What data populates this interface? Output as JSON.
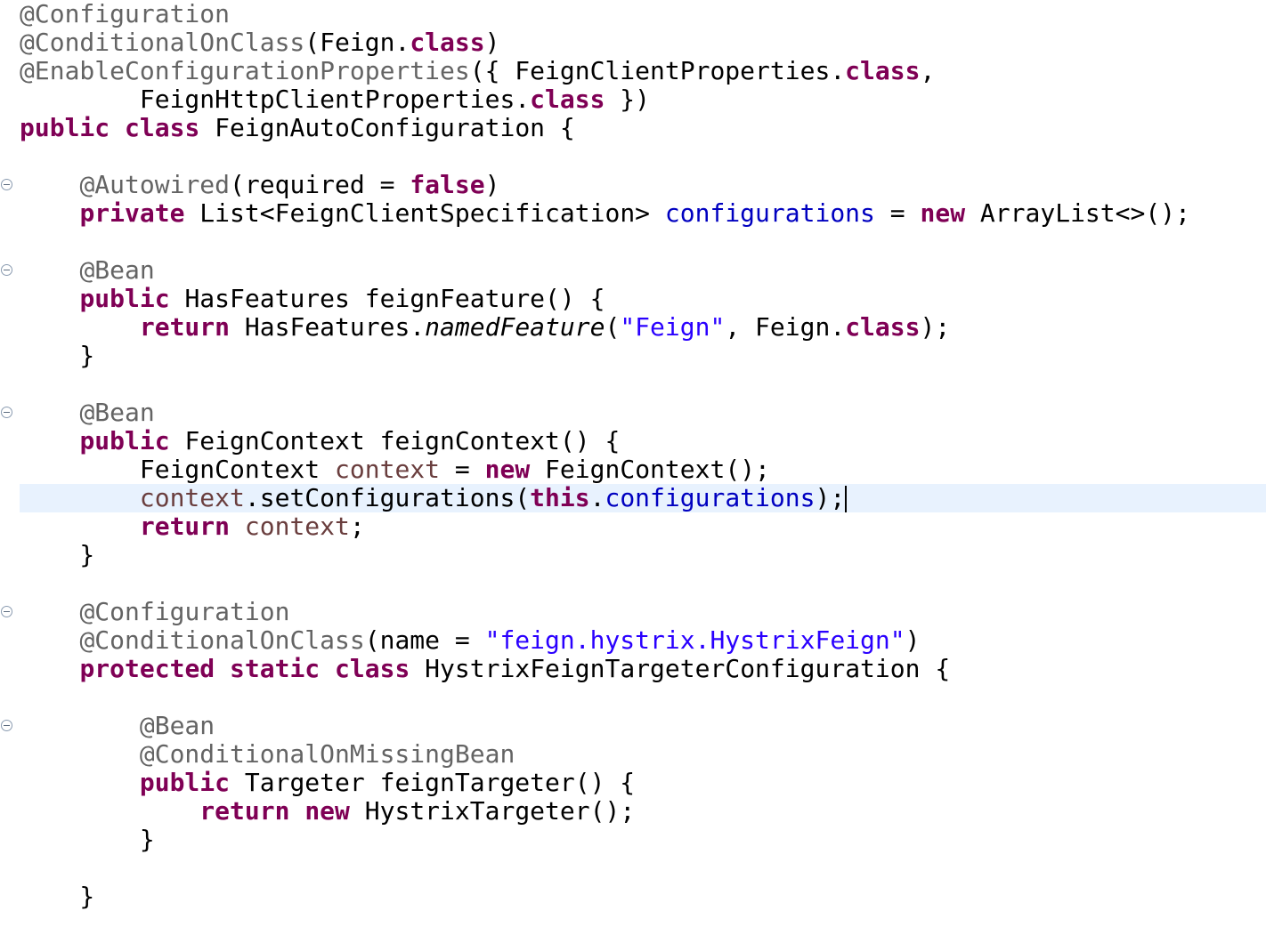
{
  "editor": {
    "fold_markers": [
      "collapse",
      "collapse",
      "collapse",
      "collapse",
      "collapse"
    ],
    "colors": {
      "keyword": "#7f0055",
      "annotation": "#646464",
      "string": "#2a00ff",
      "field": "#0000c0",
      "local_variable": "#6a3e3e",
      "plain": "#000000",
      "current_line_highlight": "#e8f2fe"
    },
    "lines": [
      {
        "tokens": [
          {
            "t": "@Configuration",
            "k": "ann"
          }
        ]
      },
      {
        "tokens": [
          {
            "t": "@ConditionalOnClass",
            "k": "ann"
          },
          {
            "t": "(Feign."
          },
          {
            "t": "class",
            "k": "kw"
          },
          {
            "t": ")"
          }
        ]
      },
      {
        "tokens": [
          {
            "t": "@EnableConfigurationProperties",
            "k": "ann"
          },
          {
            "t": "({ FeignClientProperties."
          },
          {
            "t": "class",
            "k": "kw"
          },
          {
            "t": ","
          }
        ]
      },
      {
        "tokens": [
          {
            "t": "        FeignHttpClientProperties."
          },
          {
            "t": "class",
            "k": "kw"
          },
          {
            "t": " })"
          }
        ]
      },
      {
        "tokens": [
          {
            "t": "public",
            "k": "kw"
          },
          {
            "t": " "
          },
          {
            "t": "class",
            "k": "kw"
          },
          {
            "t": " FeignAutoConfiguration {"
          }
        ]
      },
      {
        "tokens": []
      },
      {
        "fold": true,
        "tokens": [
          {
            "t": "    "
          },
          {
            "t": "@Autowired",
            "k": "ann"
          },
          {
            "t": "(required = "
          },
          {
            "t": "false",
            "k": "kw"
          },
          {
            "t": ")"
          }
        ]
      },
      {
        "tokens": [
          {
            "t": "    "
          },
          {
            "t": "private",
            "k": "kw"
          },
          {
            "t": " List<FeignClientSpecification> "
          },
          {
            "t": "configurations",
            "k": "field"
          },
          {
            "t": " = "
          },
          {
            "t": "new",
            "k": "kw"
          },
          {
            "t": " ArrayList<>();"
          }
        ]
      },
      {
        "tokens": []
      },
      {
        "fold": true,
        "tokens": [
          {
            "t": "    "
          },
          {
            "t": "@Bean",
            "k": "ann"
          }
        ]
      },
      {
        "tokens": [
          {
            "t": "    "
          },
          {
            "t": "public",
            "k": "kw"
          },
          {
            "t": " HasFeatures feignFeature() {"
          }
        ]
      },
      {
        "tokens": [
          {
            "t": "        "
          },
          {
            "t": "return",
            "k": "kw"
          },
          {
            "t": " HasFeatures."
          },
          {
            "t": "namedFeature",
            "k": "static"
          },
          {
            "t": "("
          },
          {
            "t": "\"Feign\"",
            "k": "str"
          },
          {
            "t": ", Feign."
          },
          {
            "t": "class",
            "k": "kw"
          },
          {
            "t": ");"
          }
        ]
      },
      {
        "tokens": [
          {
            "t": "    }"
          }
        ]
      },
      {
        "tokens": []
      },
      {
        "fold": true,
        "tokens": [
          {
            "t": "    "
          },
          {
            "t": "@Bean",
            "k": "ann"
          }
        ]
      },
      {
        "tokens": [
          {
            "t": "    "
          },
          {
            "t": "public",
            "k": "kw"
          },
          {
            "t": " FeignContext feignContext() {"
          }
        ]
      },
      {
        "tokens": [
          {
            "t": "        FeignContext "
          },
          {
            "t": "context",
            "k": "local"
          },
          {
            "t": " = "
          },
          {
            "t": "new",
            "k": "kw"
          },
          {
            "t": " FeignContext();"
          }
        ]
      },
      {
        "current": true,
        "caret": true,
        "tokens": [
          {
            "t": "        "
          },
          {
            "t": "context",
            "k": "local"
          },
          {
            "t": ".setConfigurations("
          },
          {
            "t": "this",
            "k": "kw"
          },
          {
            "t": "."
          },
          {
            "t": "configurations",
            "k": "field"
          },
          {
            "t": ");"
          }
        ]
      },
      {
        "tokens": [
          {
            "t": "        "
          },
          {
            "t": "return",
            "k": "kw"
          },
          {
            "t": " "
          },
          {
            "t": "context",
            "k": "local"
          },
          {
            "t": ";"
          }
        ]
      },
      {
        "tokens": [
          {
            "t": "    }"
          }
        ]
      },
      {
        "tokens": []
      },
      {
        "fold": true,
        "tokens": [
          {
            "t": "    "
          },
          {
            "t": "@Configuration",
            "k": "ann"
          }
        ]
      },
      {
        "tokens": [
          {
            "t": "    "
          },
          {
            "t": "@ConditionalOnClass",
            "k": "ann"
          },
          {
            "t": "(name = "
          },
          {
            "t": "\"feign.hystrix.HystrixFeign\"",
            "k": "str"
          },
          {
            "t": ")"
          }
        ]
      },
      {
        "tokens": [
          {
            "t": "    "
          },
          {
            "t": "protected",
            "k": "kw"
          },
          {
            "t": " "
          },
          {
            "t": "static",
            "k": "kw"
          },
          {
            "t": " "
          },
          {
            "t": "class",
            "k": "kw"
          },
          {
            "t": " HystrixFeignTargeterConfiguration {"
          }
        ]
      },
      {
        "tokens": []
      },
      {
        "fold": true,
        "tokens": [
          {
            "t": "        "
          },
          {
            "t": "@Bean",
            "k": "ann"
          }
        ]
      },
      {
        "tokens": [
          {
            "t": "        "
          },
          {
            "t": "@ConditionalOnMissingBean",
            "k": "ann"
          }
        ]
      },
      {
        "tokens": [
          {
            "t": "        "
          },
          {
            "t": "public",
            "k": "kw"
          },
          {
            "t": " Targeter feignTargeter() {"
          }
        ]
      },
      {
        "tokens": [
          {
            "t": "            "
          },
          {
            "t": "return",
            "k": "kw"
          },
          {
            "t": " "
          },
          {
            "t": "new",
            "k": "kw"
          },
          {
            "t": " HystrixTargeter();"
          }
        ]
      },
      {
        "tokens": [
          {
            "t": "        }"
          }
        ]
      },
      {
        "tokens": []
      },
      {
        "tokens": [
          {
            "t": "    }"
          }
        ]
      }
    ]
  }
}
